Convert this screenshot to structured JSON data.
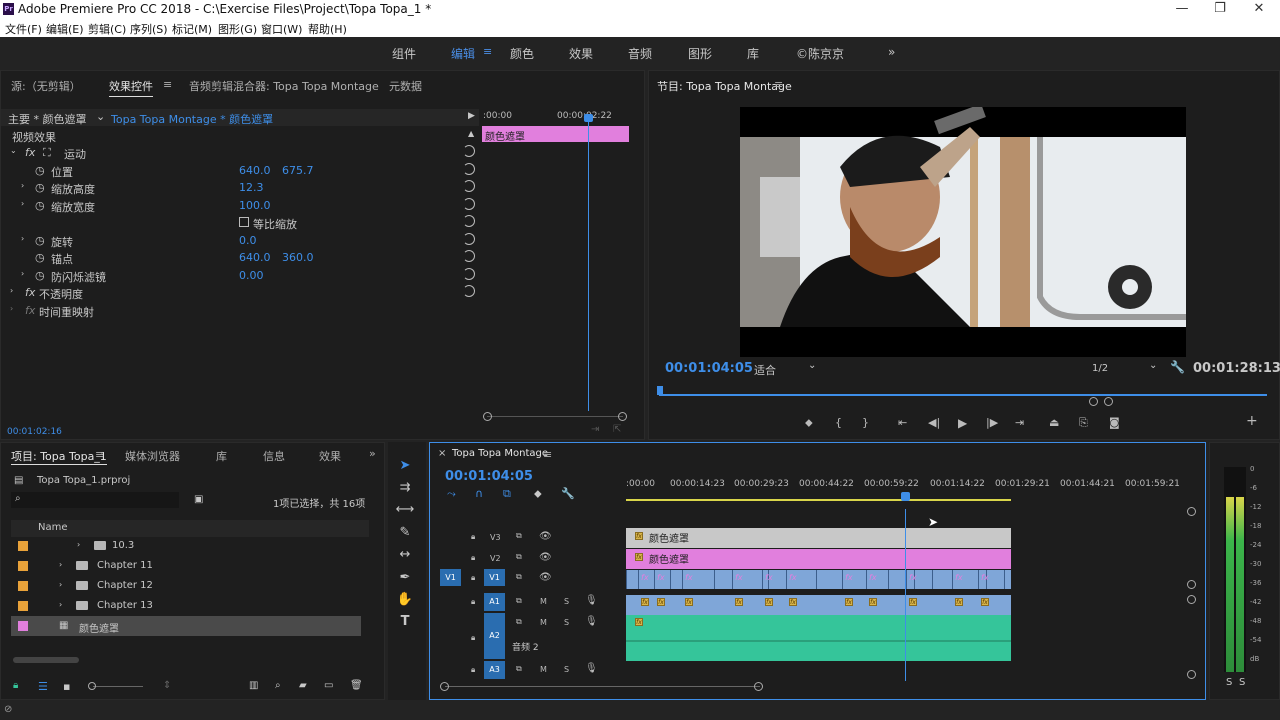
{
  "app": {
    "title": "Adobe Premiere Pro CC 2018 - C:\\Exercise Files\\Project\\Topa Topa_1 *",
    "logo_text": "Pr"
  },
  "menu": [
    "文件(F)",
    "编辑(E)",
    "剪辑(C)",
    "序列(S)",
    "标记(M)",
    "图形(G)",
    "窗口(W)",
    "帮助(H)"
  ],
  "workspaces": [
    "组件",
    "编辑",
    "颜色",
    "效果",
    "音频",
    "图形",
    "库",
    "©陈京京"
  ],
  "colors": {
    "accent": "#3e8ee8",
    "pink_clip": "#e17fdd",
    "audio_clip": "#35c59a",
    "video_clip": "#7fa6d8"
  },
  "effect_controls": {
    "tabs": [
      "源:（无剪辑）",
      "效果控件",
      "音频剪辑混合器: Topa Topa Montage",
      "元数据"
    ],
    "header_source": "主要 * 颜色遮罩",
    "header_sequence": "Topa Topa Montage * 颜色遮罩",
    "section": "视频效果",
    "motion": "运动",
    "position_label": "位置",
    "position_x": "640.0",
    "position_y": "675.7",
    "scale_height_label": "缩放高度",
    "scale_height": "12.3",
    "scale_width_label": "缩放宽度",
    "scale_width": "100.0",
    "uniform_scale": "等比缩放",
    "rotation_label": "旋转",
    "rotation": "0.0",
    "anchor_label": "锚点",
    "anchor_x": "640.0",
    "anchor_y": "360.0",
    "flicker_label": "防闪烁滤镜",
    "flicker": "0.00",
    "opacity": "不透明度",
    "time_remap": "时间重映射",
    "mini_ruler_start": ":00:00",
    "mini_ruler_mid": "00:00:02:22",
    "mini_clip": "颜色遮罩",
    "timecode": "00:01:02:16"
  },
  "program": {
    "title": "节目: Topa Topa Montage",
    "timecode": "00:01:04:05",
    "fit": "适合",
    "resolution": "1/2",
    "duration": "00:01:28:13",
    "playhead_fraction": 0.0
  },
  "project": {
    "tabs": [
      "项目: Topa Topa_1",
      "媒体浏览器",
      "库",
      "信息",
      "效果"
    ],
    "file": "Topa Topa_1.prproj",
    "selection": "1项已选择，共 16项",
    "column_name": "Name",
    "items": [
      {
        "name": "10.3",
        "color": "#e8a23a"
      },
      {
        "name": "Chapter 11",
        "color": "#e8a23a"
      },
      {
        "name": "Chapter 12",
        "color": "#e8a23a"
      },
      {
        "name": "Chapter 13",
        "color": "#e8a23a"
      },
      {
        "name": "颜色遮罩",
        "color": "#e17fdd"
      }
    ]
  },
  "timeline": {
    "tab": "Topa Topa Montage",
    "timecode": "00:01:04:05",
    "ruler": [
      ":00:00",
      "00:00:14:23",
      "00:00:29:23",
      "00:00:44:22",
      "00:00:59:22",
      "00:01:14:22",
      "00:01:29:21",
      "00:01:44:21",
      "00:01:59:21"
    ],
    "tracks": {
      "v3": "V3",
      "v2": "V2",
      "v1": "V1",
      "a1": "A1",
      "a2": "A2",
      "a3": "A3",
      "src_v1": "V1",
      "m": "M",
      "s": "S"
    },
    "v3_clip": "颜色遮罩",
    "v2_clip": "颜色遮罩",
    "a2_name": "音频 2"
  },
  "meter": {
    "labels": [
      "0",
      "-6",
      "-12",
      "-18",
      "-24",
      "-30",
      "-36",
      "-42",
      "-48",
      "-54",
      "dB"
    ],
    "solo": [
      "S",
      "S"
    ]
  }
}
